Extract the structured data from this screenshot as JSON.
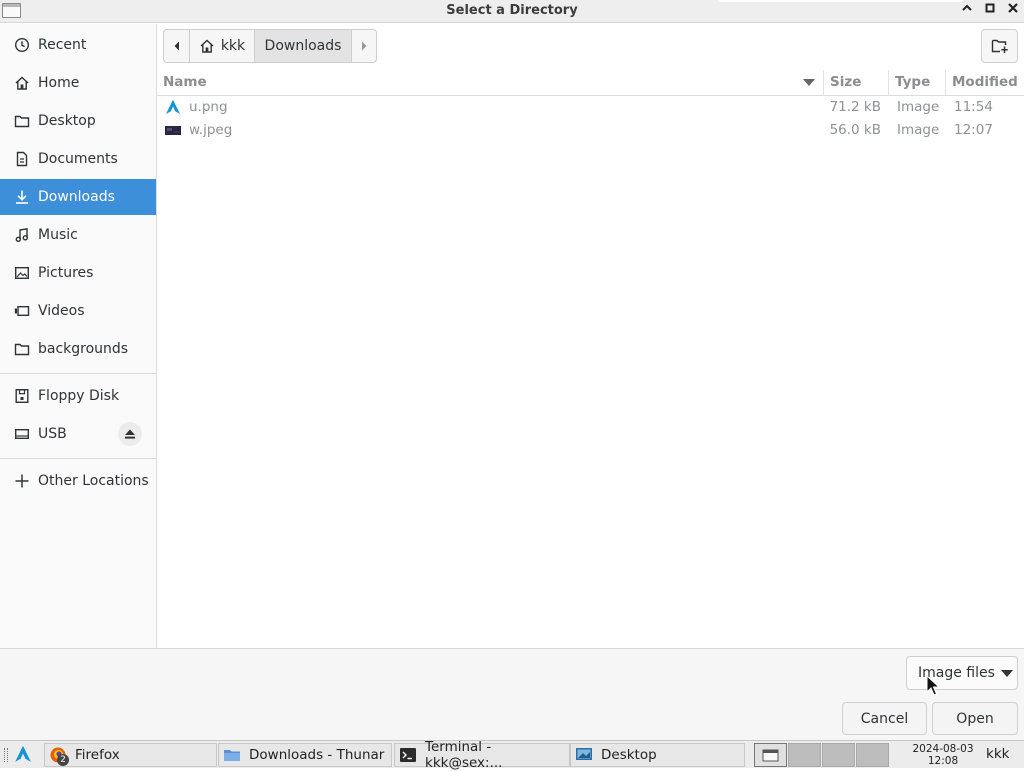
{
  "window": {
    "title": "Select a Directory",
    "controls": {
      "minimize": "^",
      "maximize": "▫",
      "close": "✕"
    }
  },
  "sidebar": {
    "items": [
      {
        "label": "Recent",
        "icon": "clock-icon"
      },
      {
        "label": "Home",
        "icon": "home-icon"
      },
      {
        "label": "Desktop",
        "icon": "folder-icon"
      },
      {
        "label": "Documents",
        "icon": "document-icon"
      },
      {
        "label": "Downloads",
        "icon": "download-icon",
        "active": true
      },
      {
        "label": "Music",
        "icon": "music-icon"
      },
      {
        "label": "Pictures",
        "icon": "picture-icon"
      },
      {
        "label": "Videos",
        "icon": "video-icon"
      },
      {
        "label": "backgrounds",
        "icon": "folder-icon"
      }
    ],
    "devices": [
      {
        "label": "Floppy Disk",
        "icon": "floppy-icon"
      },
      {
        "label": "USB",
        "icon": "drive-icon",
        "eject": true
      }
    ],
    "other": {
      "label": "Other Locations",
      "icon": "plus-icon"
    }
  },
  "pathbar": {
    "segments": [
      "kkk",
      "Downloads"
    ],
    "current": "Downloads"
  },
  "filelist": {
    "columns": [
      "Name",
      "Size",
      "Type",
      "Modified"
    ],
    "sort_column": "Name",
    "rows": [
      {
        "name": "u.png",
        "size": "71.2 kB",
        "type": "Image",
        "modified": "11:54",
        "icon": "arch-logo-icon"
      },
      {
        "name": "w.jpeg",
        "size": "56.0 kB",
        "type": "Image",
        "modified": "12:07",
        "icon": "image-thumbnail-icon"
      }
    ]
  },
  "footer": {
    "filter_label": "Image files",
    "cancel_label": "Cancel",
    "open_label": "Open"
  },
  "taskbar": {
    "tasks": [
      {
        "label": "Firefox",
        "badge": "2"
      },
      {
        "label": "Downloads - Thunar"
      },
      {
        "label": "Terminal - kkk@sex:..."
      },
      {
        "label": "Desktop"
      }
    ],
    "clock_date": "2024-08-03",
    "clock_time": "12:08",
    "user": "kkk"
  },
  "colors": {
    "selection": "#3d8fd9",
    "arch_blue": "#1793d1"
  }
}
